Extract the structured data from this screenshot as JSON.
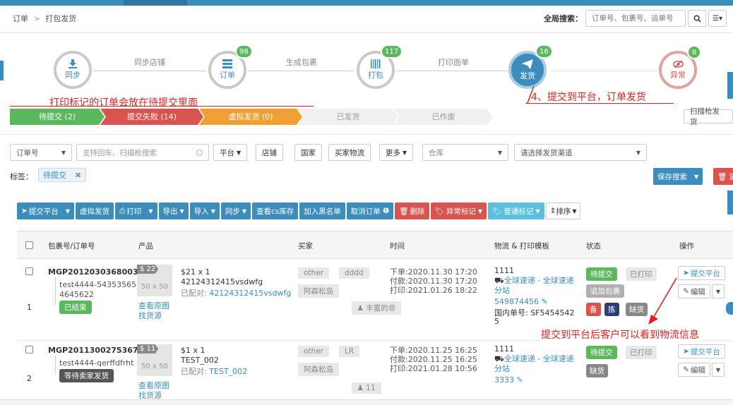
{
  "breadcrumb": {
    "root": "订单",
    "sep": ">",
    "current": "打包发货"
  },
  "global_search": {
    "label": "全局搜索：",
    "placeholder": "订单号、包裹号、运单号"
  },
  "steps": [
    {
      "label": "同步",
      "badge": ""
    },
    {
      "label": "订单",
      "badge": "98"
    },
    {
      "label": "打包",
      "badge": "117"
    },
    {
      "label": "发货",
      "badge": "16"
    },
    {
      "label": "异常",
      "badge": "8"
    }
  ],
  "connectors": [
    "同步店铺",
    "生成包裹",
    "打印面单"
  ],
  "annotations": {
    "a1": "打印标记的订单会放在待提交里面",
    "a2": "4、提交到平台，订单发货",
    "a3": "提交到平台后客户可以看到物流信息"
  },
  "status_tabs": [
    {
      "label": "待提交 (2)",
      "color": "#5cb85c"
    },
    {
      "label": "提交失败 (14)",
      "color": "#d9534f"
    },
    {
      "label": "虚拟发货 (0)",
      "color": "#f0a030"
    },
    {
      "label": "已发货",
      "color": ""
    },
    {
      "label": "已作废",
      "color": ""
    }
  ],
  "scan_button": "扫描枪发货",
  "filters": {
    "order_type": "订单号",
    "search_placeholder": "支持回车、扫描枪搜索",
    "platform": "平台",
    "shop": "店铺",
    "country": "国家",
    "buyer_logistics": "买家物流",
    "more": "更多",
    "warehouse": "仓库",
    "channel": "请选择发货渠道"
  },
  "tag_label": "标签：",
  "tag_chip": "待提交",
  "save_search": "保存搜索",
  "clear": "清",
  "toolbar": [
    "提交平台",
    "虚拟发货",
    "打印",
    "导出",
    "导入",
    "同步",
    "查看cs库存",
    "加入黑名单",
    "取消订单",
    "删除",
    "异常标记",
    "普通标记",
    "排序"
  ],
  "columns": [
    "包裹号/订单号",
    "产品",
    "买家",
    "时间",
    "物流 & 打印模板",
    "状态",
    "操作"
  ],
  "rows": [
    {
      "index": "1",
      "package_no": "MGP2012030368003",
      "order_no_1": "test4444-54353565",
      "order_no_2": "4645622",
      "order_status": "已结束",
      "qty_badge": "22",
      "img": "50 x 50",
      "price": "$21 x 1",
      "sku": "42124312415vsdwfg",
      "matched_label": "已配对:",
      "matched": "42124312415vsdwfg",
      "view_img": "查看原图",
      "find_source": "找货源",
      "buyer_tags": [
        "other",
        "dddd"
      ],
      "buyer_country": "阿森松岛",
      "buyer_name": "丰富的非",
      "time_order": "下单:2020.11.30 17:20",
      "time_pay": "付款:2020.11.30 17:20",
      "time_print": "打印:2021.01.26 18:22",
      "log_code": "1111",
      "log_name": "全球速递 - 全球速递分站",
      "tracking": "549874456",
      "domestic": "国内单号: SF5454542",
      "domestic2": "5",
      "status_a": "待提交",
      "status_b": "已打印",
      "status_c": "追加包裹",
      "marks": [
        "备",
        "拣",
        "缺货"
      ],
      "op_submit": "提交平台",
      "op_edit": "编辑"
    },
    {
      "index": "2",
      "package_no": "MGP2011300275367",
      "order_no_1": "test4444-qerffdfrht",
      "order_status": "等待卖家发货",
      "qty_badge": "11",
      "img": "50 x 50",
      "price": "$1 x 1",
      "sku": "TEST_002",
      "matched_label": "已配对:",
      "matched": "TEST_002",
      "view_img": "查看原图",
      "find_source": "找货源",
      "buyer_tags": [
        "other",
        "LR"
      ],
      "buyer_country": "阿森松岛",
      "buyer_name": "11",
      "time_order": "下单:2020.11.25 16:25",
      "time_pay": "付款:2020.11.25 16:25",
      "time_print": "打印:2021.01.28 10:56",
      "log_code": "1111",
      "log_name": "全球速递 - 全球速递分站",
      "tracking": "3333",
      "status_a": "待提交",
      "status_b": "已打印",
      "mark": "缺货",
      "op_submit": "提交平台",
      "op_edit": "编辑"
    }
  ]
}
